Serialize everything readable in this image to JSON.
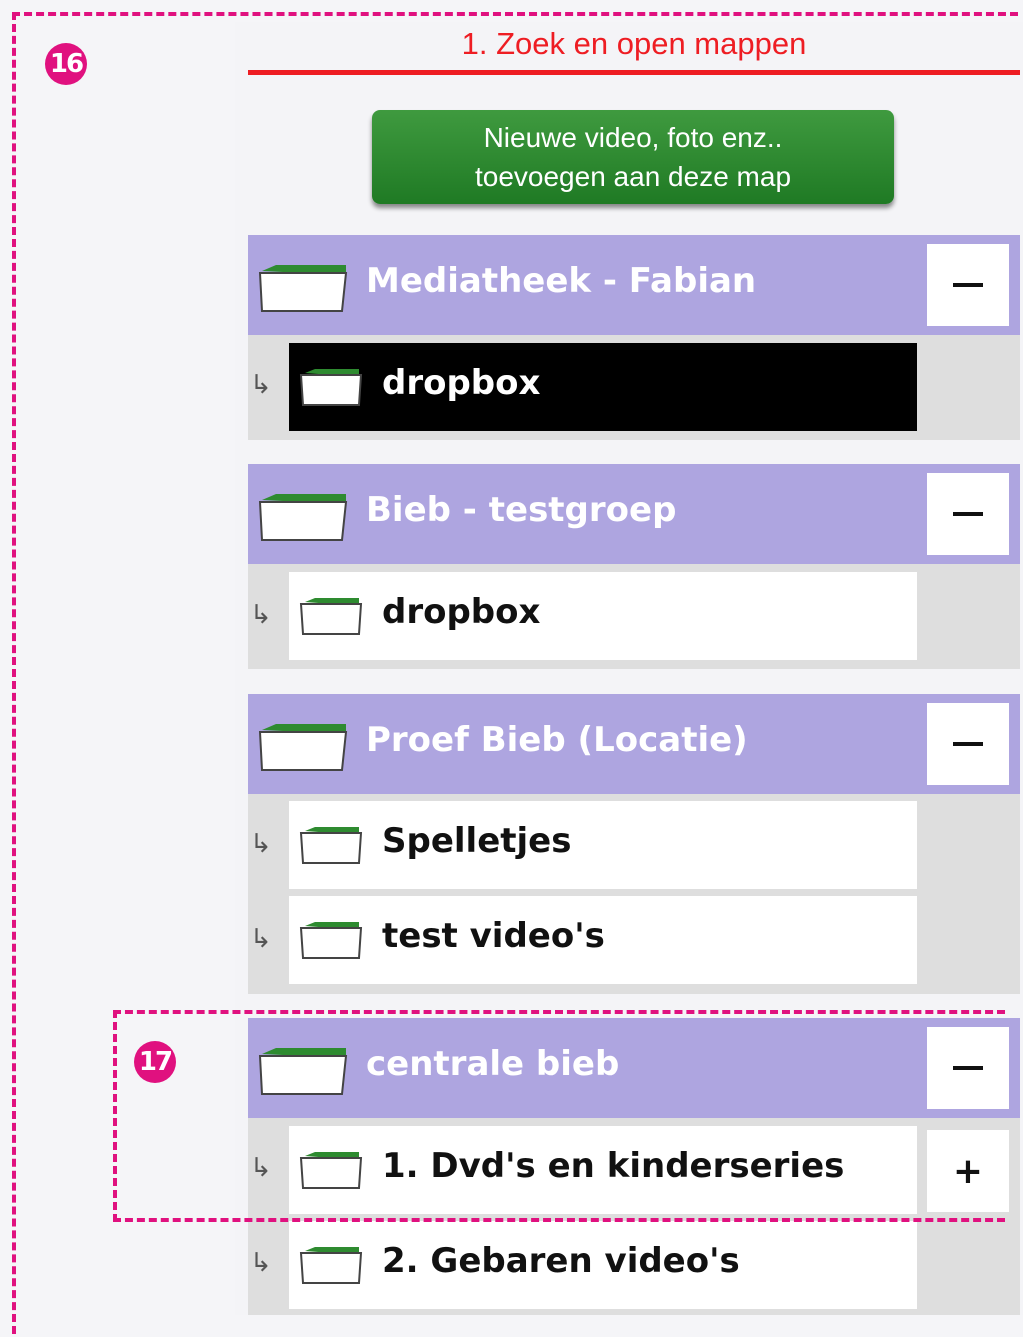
{
  "callouts": {
    "outer": "16",
    "inner": "17"
  },
  "title": "1. Zoek en open mappen",
  "add_button": {
    "line1": "Nieuwe video, foto enz..",
    "line2": "toevoegen aan deze map"
  },
  "groups": [
    {
      "name": "Mediatheek - Fabian",
      "collapse": "−",
      "children": [
        {
          "name": "dropbox",
          "selected": true
        }
      ]
    },
    {
      "name": "Bieb - testgroep",
      "collapse": "−",
      "children": [
        {
          "name": "dropbox"
        }
      ]
    },
    {
      "name": "Proef Bieb (Locatie)",
      "collapse": "−",
      "children": [
        {
          "name": "Spelletjes"
        },
        {
          "name": "test video's"
        }
      ]
    },
    {
      "name": "centrale bieb",
      "collapse": "−",
      "children": [
        {
          "name": "1. Dvd's en kinderseries",
          "expand": "+"
        },
        {
          "name": "2. Gebaren video's"
        }
      ]
    }
  ],
  "child_arrow": "↳",
  "colors": {
    "accent": "#e0117f",
    "title": "#ee1d23",
    "group_header": "#aea5e0",
    "button": "#2a8a2e",
    "folder_tab": "#2e8b30"
  }
}
